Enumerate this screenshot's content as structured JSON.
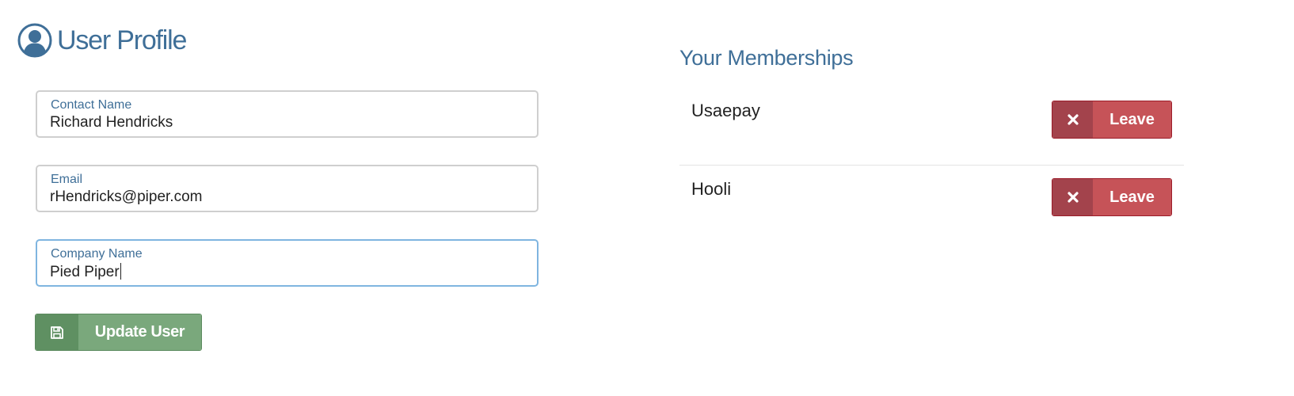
{
  "profile": {
    "title": "User Profile",
    "icon": "user-circle-icon",
    "accent_color": "#3f6f98"
  },
  "form": {
    "fields": [
      {
        "label": "Contact Name",
        "value": "Richard Hendricks",
        "focused": false
      },
      {
        "label": "Email",
        "value": "rHendricks@piper.com",
        "focused": false
      },
      {
        "label": "Company Name",
        "value": "Pied Piper",
        "focused": true
      }
    ],
    "update_button": {
      "label": "Update User",
      "icon": "save-icon",
      "color": "#7aa87c"
    }
  },
  "memberships": {
    "title": "Your Memberships",
    "items": [
      {
        "name": "Usaepay",
        "action_label": "Leave",
        "action_icon": "close-icon"
      },
      {
        "name": "Hooli",
        "action_label": "Leave",
        "action_icon": "close-icon"
      }
    ],
    "leave_color": "#c65358"
  }
}
